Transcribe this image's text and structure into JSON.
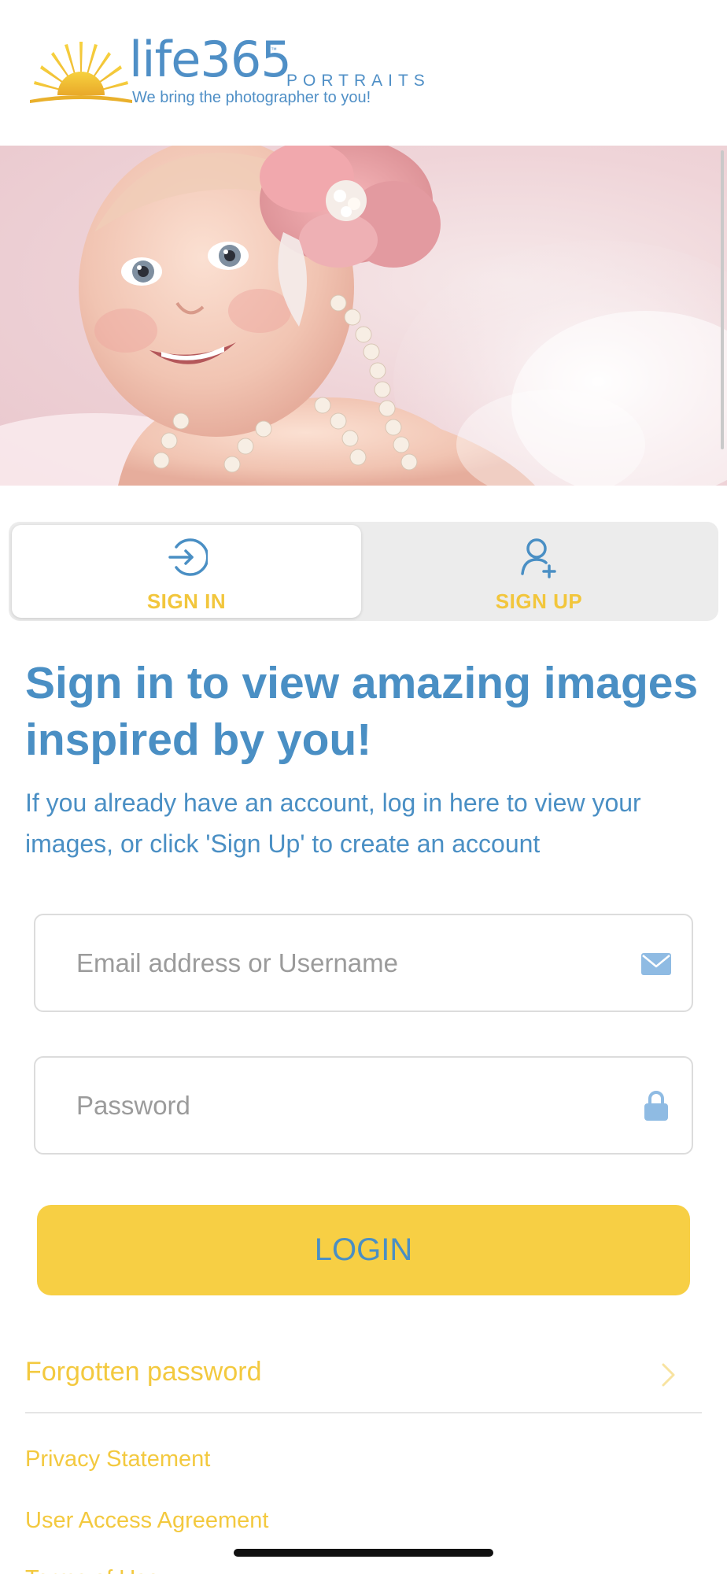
{
  "brand": {
    "name": "life365",
    "tm": "™",
    "product": "PORTRAITS",
    "tagline": "We bring the photographer to you!"
  },
  "hero": {
    "icon": "baby-portrait-photo"
  },
  "tabs": [
    {
      "label": "SIGN IN",
      "icon": "sign-in-icon",
      "active": true
    },
    {
      "label": "SIGN UP",
      "icon": "add-user-icon",
      "active": false
    }
  ],
  "heading": "Sign in to view amazing images inspired by you!",
  "intro": "If you already have an account, log in here to view your images, or click 'Sign Up' to create an account",
  "form": {
    "email": {
      "placeholder": "Email address or Username",
      "value": "",
      "icon": "mail-icon"
    },
    "password": {
      "placeholder": "Password",
      "value": "",
      "icon": "lock-icon"
    },
    "login_label": "LOGIN"
  },
  "links": {
    "forgot": "Forgotten password",
    "privacy": "Privacy Statement",
    "user_access": "User Access Agreement",
    "terms": "Terms of Use"
  },
  "colors": {
    "brand_blue": "#4a8fc4",
    "brand_yellow": "#f7cf44",
    "link_yellow": "#f3c93f",
    "tab_bg": "#ececec"
  }
}
